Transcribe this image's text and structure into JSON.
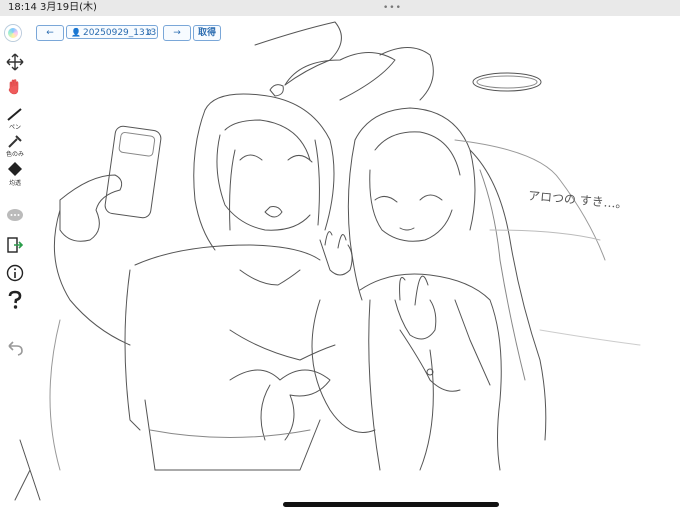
{
  "statusbar": {
    "time": "18:14",
    "date": "3月19日(木)",
    "more": "•••"
  },
  "toolbar": {
    "back_label": "←",
    "project_icon": "person-icon",
    "project_value": "20250929_1313",
    "dropdown_icon": "chevron-updown-icon",
    "forward_label": "→",
    "fetch_label": "取得"
  },
  "tools": {
    "pen_label": "ペン",
    "eyedropper_label": "色のみ",
    "transparent_label": "均透"
  },
  "canvas": {
    "handwritten_note": "アロつの すき…。"
  },
  "colors": {
    "accent": "#2b6cb0",
    "hand_tool": "#ef5b5b",
    "statusbar": "#e9e9e9"
  }
}
